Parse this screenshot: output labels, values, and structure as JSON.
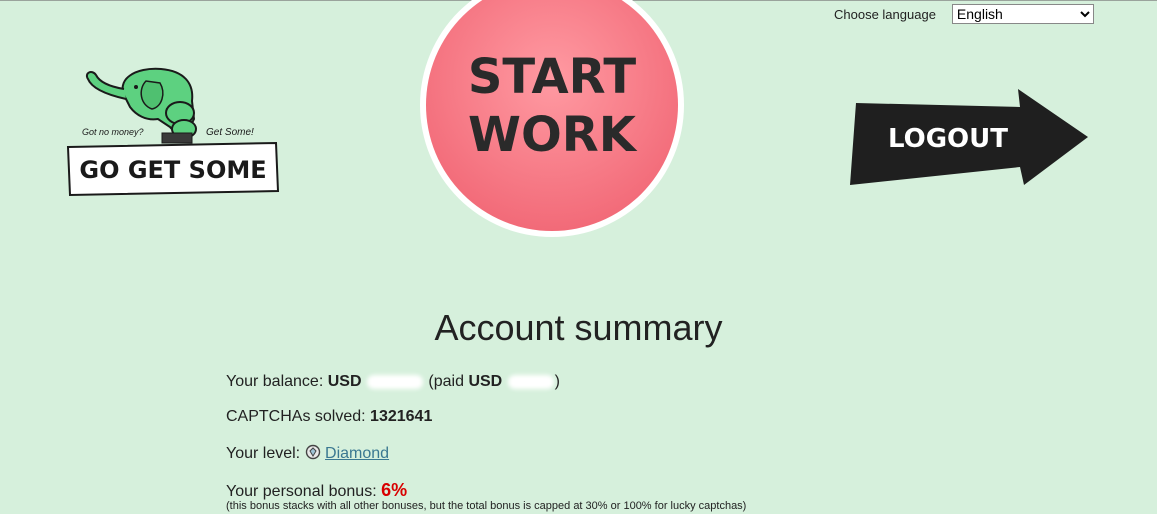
{
  "header": {
    "language_label": "Choose language",
    "language_selected": "English"
  },
  "logo": {
    "tagline_left": "Got no money?",
    "tagline_right": "Get Some!",
    "brand": "GO GET SOME"
  },
  "start_button": {
    "line1": "START",
    "line2": "WORK"
  },
  "logout_button": {
    "label": "LOGOUT"
  },
  "summary": {
    "title": "Account summary",
    "balance_label": "Your balance: ",
    "balance_currency": "USD",
    "paid_label": "(paid ",
    "paid_currency": "USD",
    "paid_close": ")",
    "captchas_label": "CAPTCHAs solved: ",
    "captchas_value": "1321641",
    "level_label": "Your level: ",
    "level_value": "Diamond",
    "level_icon": "diamond-badge-icon",
    "bonus_label": "Your personal bonus: ",
    "bonus_value": "6%",
    "bonus_note": "(this bonus stacks with all other bonuses, but the total bonus is capped at 30% or 100% for lucky captchas)"
  },
  "colors": {
    "background": "#d6f0dc",
    "start_button": "#f7737f",
    "logo_elephant": "#5dd180",
    "logout_arrow": "#1f1f1f",
    "link": "#3a7891",
    "bonus": "#d80000"
  }
}
